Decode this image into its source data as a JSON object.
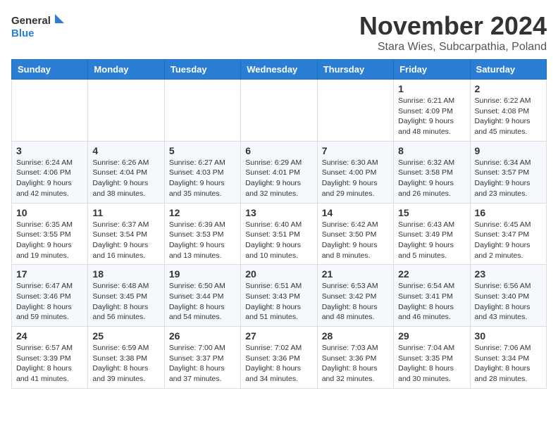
{
  "header": {
    "logo_general": "General",
    "logo_blue": "Blue",
    "month_title": "November 2024",
    "location": "Stara Wies, Subcarpathia, Poland"
  },
  "weekdays": [
    "Sunday",
    "Monday",
    "Tuesday",
    "Wednesday",
    "Thursday",
    "Friday",
    "Saturday"
  ],
  "weeks": [
    [
      {
        "day": "",
        "detail": ""
      },
      {
        "day": "",
        "detail": ""
      },
      {
        "day": "",
        "detail": ""
      },
      {
        "day": "",
        "detail": ""
      },
      {
        "day": "",
        "detail": ""
      },
      {
        "day": "1",
        "detail": "Sunrise: 6:21 AM\nSunset: 4:09 PM\nDaylight: 9 hours\nand 48 minutes."
      },
      {
        "day": "2",
        "detail": "Sunrise: 6:22 AM\nSunset: 4:08 PM\nDaylight: 9 hours\nand 45 minutes."
      }
    ],
    [
      {
        "day": "3",
        "detail": "Sunrise: 6:24 AM\nSunset: 4:06 PM\nDaylight: 9 hours\nand 42 minutes."
      },
      {
        "day": "4",
        "detail": "Sunrise: 6:26 AM\nSunset: 4:04 PM\nDaylight: 9 hours\nand 38 minutes."
      },
      {
        "day": "5",
        "detail": "Sunrise: 6:27 AM\nSunset: 4:03 PM\nDaylight: 9 hours\nand 35 minutes."
      },
      {
        "day": "6",
        "detail": "Sunrise: 6:29 AM\nSunset: 4:01 PM\nDaylight: 9 hours\nand 32 minutes."
      },
      {
        "day": "7",
        "detail": "Sunrise: 6:30 AM\nSunset: 4:00 PM\nDaylight: 9 hours\nand 29 minutes."
      },
      {
        "day": "8",
        "detail": "Sunrise: 6:32 AM\nSunset: 3:58 PM\nDaylight: 9 hours\nand 26 minutes."
      },
      {
        "day": "9",
        "detail": "Sunrise: 6:34 AM\nSunset: 3:57 PM\nDaylight: 9 hours\nand 23 minutes."
      }
    ],
    [
      {
        "day": "10",
        "detail": "Sunrise: 6:35 AM\nSunset: 3:55 PM\nDaylight: 9 hours\nand 19 minutes."
      },
      {
        "day": "11",
        "detail": "Sunrise: 6:37 AM\nSunset: 3:54 PM\nDaylight: 9 hours\nand 16 minutes."
      },
      {
        "day": "12",
        "detail": "Sunrise: 6:39 AM\nSunset: 3:53 PM\nDaylight: 9 hours\nand 13 minutes."
      },
      {
        "day": "13",
        "detail": "Sunrise: 6:40 AM\nSunset: 3:51 PM\nDaylight: 9 hours\nand 10 minutes."
      },
      {
        "day": "14",
        "detail": "Sunrise: 6:42 AM\nSunset: 3:50 PM\nDaylight: 9 hours\nand 8 minutes."
      },
      {
        "day": "15",
        "detail": "Sunrise: 6:43 AM\nSunset: 3:49 PM\nDaylight: 9 hours\nand 5 minutes."
      },
      {
        "day": "16",
        "detail": "Sunrise: 6:45 AM\nSunset: 3:47 PM\nDaylight: 9 hours\nand 2 minutes."
      }
    ],
    [
      {
        "day": "17",
        "detail": "Sunrise: 6:47 AM\nSunset: 3:46 PM\nDaylight: 8 hours\nand 59 minutes."
      },
      {
        "day": "18",
        "detail": "Sunrise: 6:48 AM\nSunset: 3:45 PM\nDaylight: 8 hours\nand 56 minutes."
      },
      {
        "day": "19",
        "detail": "Sunrise: 6:50 AM\nSunset: 3:44 PM\nDaylight: 8 hours\nand 54 minutes."
      },
      {
        "day": "20",
        "detail": "Sunrise: 6:51 AM\nSunset: 3:43 PM\nDaylight: 8 hours\nand 51 minutes."
      },
      {
        "day": "21",
        "detail": "Sunrise: 6:53 AM\nSunset: 3:42 PM\nDaylight: 8 hours\nand 48 minutes."
      },
      {
        "day": "22",
        "detail": "Sunrise: 6:54 AM\nSunset: 3:41 PM\nDaylight: 8 hours\nand 46 minutes."
      },
      {
        "day": "23",
        "detail": "Sunrise: 6:56 AM\nSunset: 3:40 PM\nDaylight: 8 hours\nand 43 minutes."
      }
    ],
    [
      {
        "day": "24",
        "detail": "Sunrise: 6:57 AM\nSunset: 3:39 PM\nDaylight: 8 hours\nand 41 minutes."
      },
      {
        "day": "25",
        "detail": "Sunrise: 6:59 AM\nSunset: 3:38 PM\nDaylight: 8 hours\nand 39 minutes."
      },
      {
        "day": "26",
        "detail": "Sunrise: 7:00 AM\nSunset: 3:37 PM\nDaylight: 8 hours\nand 37 minutes."
      },
      {
        "day": "27",
        "detail": "Sunrise: 7:02 AM\nSunset: 3:36 PM\nDaylight: 8 hours\nand 34 minutes."
      },
      {
        "day": "28",
        "detail": "Sunrise: 7:03 AM\nSunset: 3:36 PM\nDaylight: 8 hours\nand 32 minutes."
      },
      {
        "day": "29",
        "detail": "Sunrise: 7:04 AM\nSunset: 3:35 PM\nDaylight: 8 hours\nand 30 minutes."
      },
      {
        "day": "30",
        "detail": "Sunrise: 7:06 AM\nSunset: 3:34 PM\nDaylight: 8 hours\nand 28 minutes."
      }
    ]
  ]
}
